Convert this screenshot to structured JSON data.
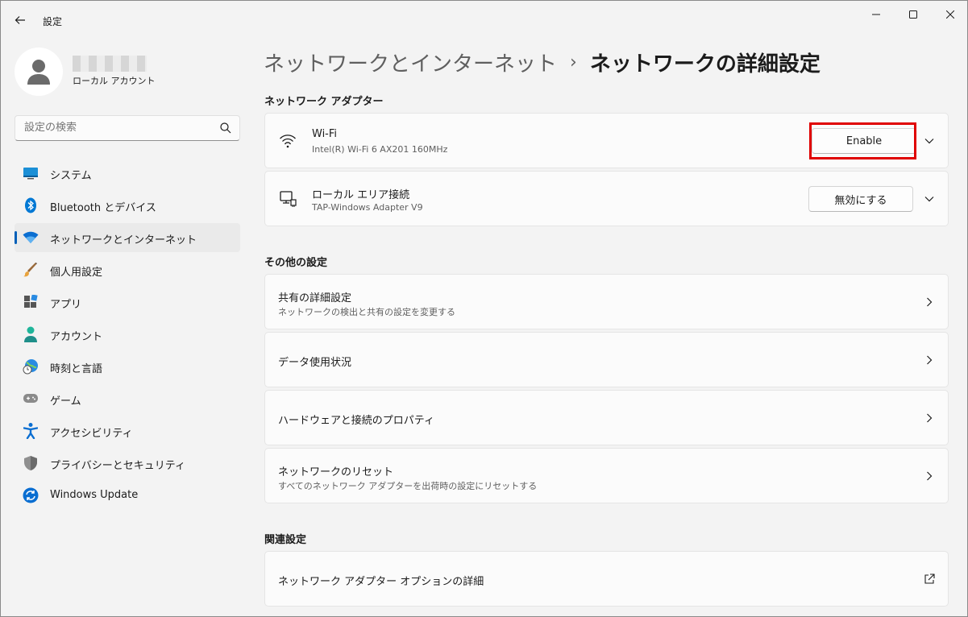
{
  "window": {
    "title": "設定"
  },
  "profile": {
    "account_type": "ローカル アカウント"
  },
  "search": {
    "placeholder": "設定の検索"
  },
  "nav": {
    "items": [
      {
        "label": "システム",
        "icon": "monitor-icon"
      },
      {
        "label": "Bluetooth とデバイス",
        "icon": "bluetooth-icon"
      },
      {
        "label": "ネットワークとインターネット",
        "icon": "wifi-icon",
        "selected": true
      },
      {
        "label": "個人用設定",
        "icon": "brush-icon"
      },
      {
        "label": "アプリ",
        "icon": "apps-icon"
      },
      {
        "label": "アカウント",
        "icon": "person-icon"
      },
      {
        "label": "時刻と言語",
        "icon": "globe-clock-icon"
      },
      {
        "label": "ゲーム",
        "icon": "gamepad-icon"
      },
      {
        "label": "アクセシビリティ",
        "icon": "accessibility-icon"
      },
      {
        "label": "プライバシーとセキュリティ",
        "icon": "shield-icon"
      },
      {
        "label": "Windows Update",
        "icon": "update-icon"
      }
    ]
  },
  "breadcrumb": {
    "parent": "ネットワークとインターネット",
    "separator": "›",
    "current": "ネットワークの詳細設定"
  },
  "adapters": {
    "section_title": "ネットワーク アダプター",
    "items": [
      {
        "title": "Wi-Fi",
        "subtitle": "Intel(R) Wi-Fi 6 AX201 160MHz",
        "button": "Enable",
        "icon": "wifi-icon"
      },
      {
        "title": "ローカル エリア接続",
        "subtitle": "TAP-Windows Adapter V9",
        "button": "無効にする",
        "icon": "ethernet-icon"
      }
    ]
  },
  "other": {
    "section_title": "その他の設定",
    "items": [
      {
        "title": "共有の詳細設定",
        "subtitle": "ネットワークの検出と共有の設定を変更する"
      },
      {
        "title": "データ使用状況"
      },
      {
        "title": "ハードウェアと接続のプロパティ"
      },
      {
        "title": "ネットワークのリセット",
        "subtitle": "すべてのネットワーク アダプターを出荷時の設定にリセットする"
      }
    ]
  },
  "related": {
    "section_title": "関連設定",
    "items": [
      {
        "title": "ネットワーク アダプター オプションの詳細"
      }
    ]
  },
  "colors": {
    "accent": "#005fb8",
    "highlight": "#e00000"
  }
}
